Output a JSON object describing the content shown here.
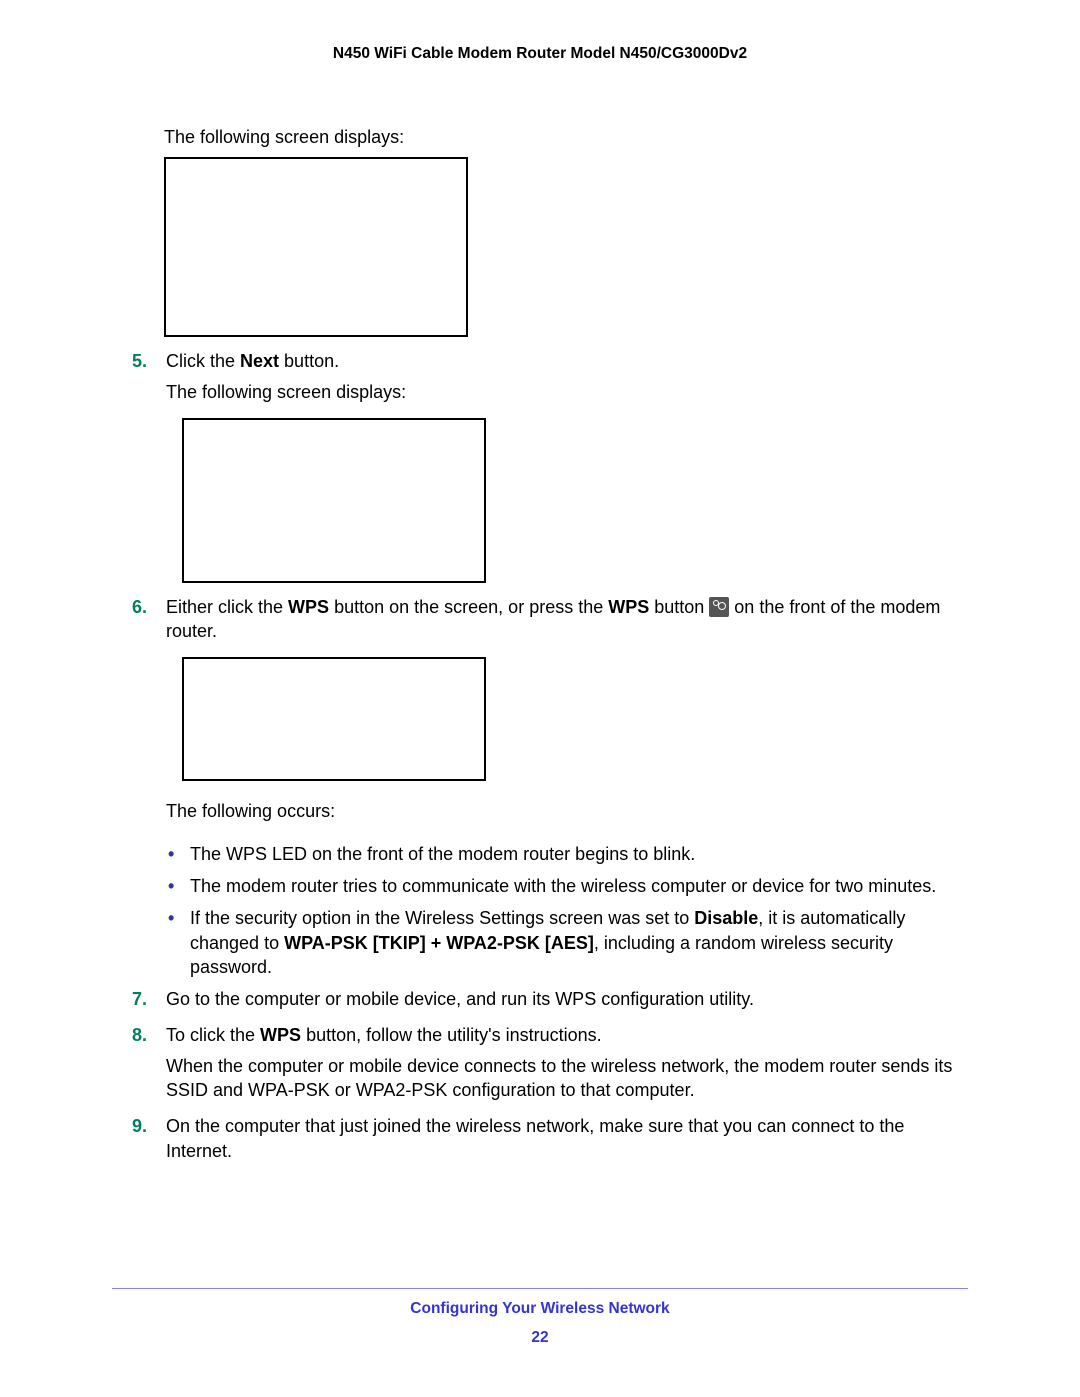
{
  "header": {
    "title": "N450 WiFi Cable Modem Router Model N450/CG3000Dv2"
  },
  "intro": {
    "text": "The following screen displays:"
  },
  "steps": {
    "s5": {
      "num": "5.",
      "line1_before": "Click the ",
      "line1_bold": "Next",
      "line1_after": " button.",
      "line2": "The following screen displays:"
    },
    "s6": {
      "num": "6.",
      "p1_a": "Either click the ",
      "p1_b": "WPS",
      "p1_c": " button         on the screen, or press the ",
      "p1_d": "WPS",
      "p1_e": " button ",
      "p1_f": " on the front of the modem router.",
      "after_box": "The following occurs:",
      "bullets": {
        "b1": "The WPS LED on the front of the modem router begins to blink.",
        "b2": "The modem router tries to communicate with the wireless computer or device for two minutes.",
        "b3_a": "If the security option in the Wireless Settings screen was set to ",
        "b3_b": "Disable",
        "b3_c": ", it is automatically changed to ",
        "b3_d": "WPA-PSK [TKIP] + WPA2-PSK [AES]",
        "b3_e": ", including a random wireless security password."
      }
    },
    "s7": {
      "num": "7.",
      "text": "Go to the computer or mobile device, and run its WPS configuration utility."
    },
    "s8": {
      "num": "8.",
      "p1_a": "To click the ",
      "p1_b": "WPS",
      "p1_c": " button, follow the utility's instructions.",
      "p2": "When the computer or mobile device connects to the wireless network, the modem router sends its SSID and WPA-PSK or WPA2-PSK configuration to that computer."
    },
    "s9": {
      "num": "9.",
      "text": "On the computer that just joined the wireless network, make sure that you can connect to the Internet."
    }
  },
  "footer": {
    "section": "Configuring Your Wireless Network",
    "page": "22"
  }
}
